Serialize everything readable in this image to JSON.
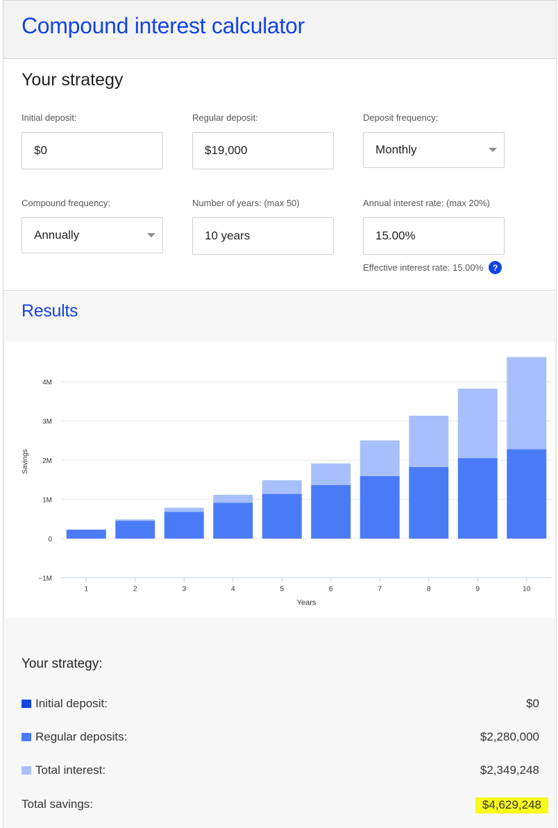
{
  "header": {
    "title": "Compound interest calculator"
  },
  "strategy": {
    "title": "Your strategy",
    "initial_deposit": {
      "label": "Initial deposit:",
      "value": "$0"
    },
    "regular_deposit": {
      "label": "Regular deposit:",
      "value": "$19,000"
    },
    "deposit_frequency": {
      "label": "Deposit frequency:",
      "value": "Monthly"
    },
    "compound_frequency": {
      "label": "Compound frequency:",
      "value": "Annually"
    },
    "years": {
      "label": "Number of years: (max 50)",
      "value": "10 years"
    },
    "rate": {
      "label": "Annual interest rate: (max 20%)",
      "value": "15.00%"
    },
    "effective_rate": "Effective interest rate: 15.00%",
    "help_icon": "?"
  },
  "results": {
    "title": "Results"
  },
  "chart_data": {
    "type": "bar",
    "stacked": true,
    "xlabel": "Years",
    "ylabel": "Savings",
    "categories": [
      "1",
      "2",
      "3",
      "4",
      "5",
      "6",
      "7",
      "8",
      "9",
      "10"
    ],
    "yticks": [
      -1000000,
      0,
      1000000,
      2000000,
      3000000,
      4000000
    ],
    "ytick_labels": [
      "−1M",
      "0",
      "1M",
      "2M",
      "3M",
      "4M"
    ],
    "ylim": [
      -1000000,
      4600000
    ],
    "grid": true,
    "series": [
      {
        "values": [
          0,
          0,
          0,
          0,
          0,
          0,
          0,
          0,
          0,
          0
        ],
        "color": "#1244e6"
      },
      {
        "values": [
          228000,
          456000,
          684000,
          912000,
          1140000,
          1368000,
          1596000,
          1824000,
          2052000,
          2280000
        ],
        "color": "#4a7bf7"
      },
      {
        "values": [
          0,
          34200,
          102600,
          205200,
          347700,
          548500,
          908000,
          1310000,
          1770000,
          2349248
        ],
        "color": "#a7bffb"
      }
    ]
  },
  "summary": {
    "title": "Your strategy:",
    "initial": {
      "label": "Initial deposit:",
      "value": "$0",
      "color": "#1244e6"
    },
    "regular": {
      "label": "Regular deposits:",
      "value": "$2,280,000",
      "color": "#4a7bf7"
    },
    "interest": {
      "label": "Total interest:",
      "value": "$2,349,248",
      "color": "#a7bffb"
    },
    "total": {
      "label": "Total savings:",
      "value": "$4,629,248",
      "highlight": "#f9f91a"
    }
  }
}
